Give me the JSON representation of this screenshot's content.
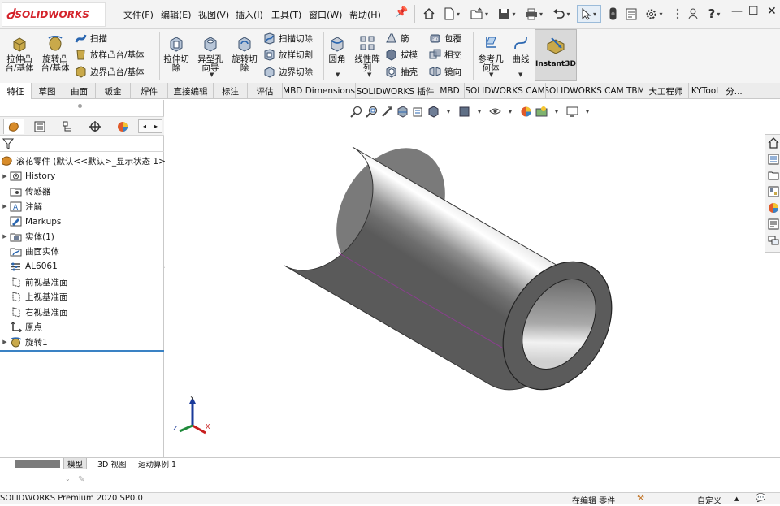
{
  "app": {
    "logo_text": "SOLIDWORKS",
    "status_text": "SOLIDWORKS Premium 2020 SP0.0"
  },
  "menu": {
    "items": [
      "文件(F)",
      "编辑(E)",
      "视图(V)",
      "插入(I)",
      "工具(T)",
      "窗口(W)",
      "帮助(H)"
    ]
  },
  "ribbon": {
    "extrude_boss": "拉伸凸台/基体",
    "revolve_boss": "旋转凸台/基体",
    "sweep": "扫描",
    "loft_boss": "放样凸台/基体",
    "boundary_boss": "边界凸台/基体",
    "extrude_cut": "拉伸切除",
    "hole_wizard": "异型孔向导",
    "revolve_cut": "旋转切除",
    "swept_cut": "扫描切除",
    "lofted_cut": "放样切割",
    "boundary_cut": "边界切除",
    "fillet": "圆角",
    "linear_pattern": "线性阵列",
    "rib": "筋",
    "draft": "拔模",
    "shell": "抽壳",
    "wrap": "包覆",
    "intersect": "相交",
    "mirror": "镜向",
    "ref_geometry": "参考几何体",
    "curves": "曲线",
    "instant3d": "Instant3D"
  },
  "command_tabs": [
    "特征",
    "草图",
    "曲面",
    "钣金",
    "焊件",
    "直接编辑",
    "标注",
    "评估",
    "MBD Dimensions",
    "SOLIDWORKS 插件",
    "MBD",
    "SOLIDWORKS CAM",
    "SOLIDWORKS CAM TBM",
    "大工程师",
    "KYTool",
    "分..."
  ],
  "tree": {
    "root": "滚花零件 (默认<<默认>_显示状态 1>)",
    "items": [
      {
        "label": "History",
        "icon": "history-folder-icon",
        "expandable": true
      },
      {
        "label": "传感器",
        "icon": "sensors-icon",
        "expandable": false
      },
      {
        "label": "注解",
        "icon": "annotations-icon",
        "expandable": true
      },
      {
        "label": "Markups",
        "icon": "markups-icon",
        "expandable": false
      },
      {
        "label": "实体(1)",
        "icon": "solid-bodies-icon",
        "expandable": true
      },
      {
        "label": "曲面实体",
        "icon": "surface-bodies-icon",
        "expandable": false
      },
      {
        "label": "AL6061",
        "icon": "material-icon",
        "expandable": false
      },
      {
        "label": "前视基准面",
        "icon": "plane-icon",
        "expandable": false
      },
      {
        "label": "上视基准面",
        "icon": "plane-icon",
        "expandable": false
      },
      {
        "label": "右视基准面",
        "icon": "plane-icon",
        "expandable": false
      },
      {
        "label": "原点",
        "icon": "origin-icon",
        "expandable": false
      },
      {
        "label": "旋转1",
        "icon": "revolve-feature-icon",
        "expandable": true
      }
    ]
  },
  "bottom_tabs": [
    "模型",
    "3D 视图",
    "运动算例 1"
  ],
  "status": {
    "editing": "在编辑 零件",
    "units": "自定义"
  },
  "colors": {
    "accent": "#d4242c",
    "tree_line": "#3a82c4",
    "ribbon_bg": "#f4f4f4"
  }
}
